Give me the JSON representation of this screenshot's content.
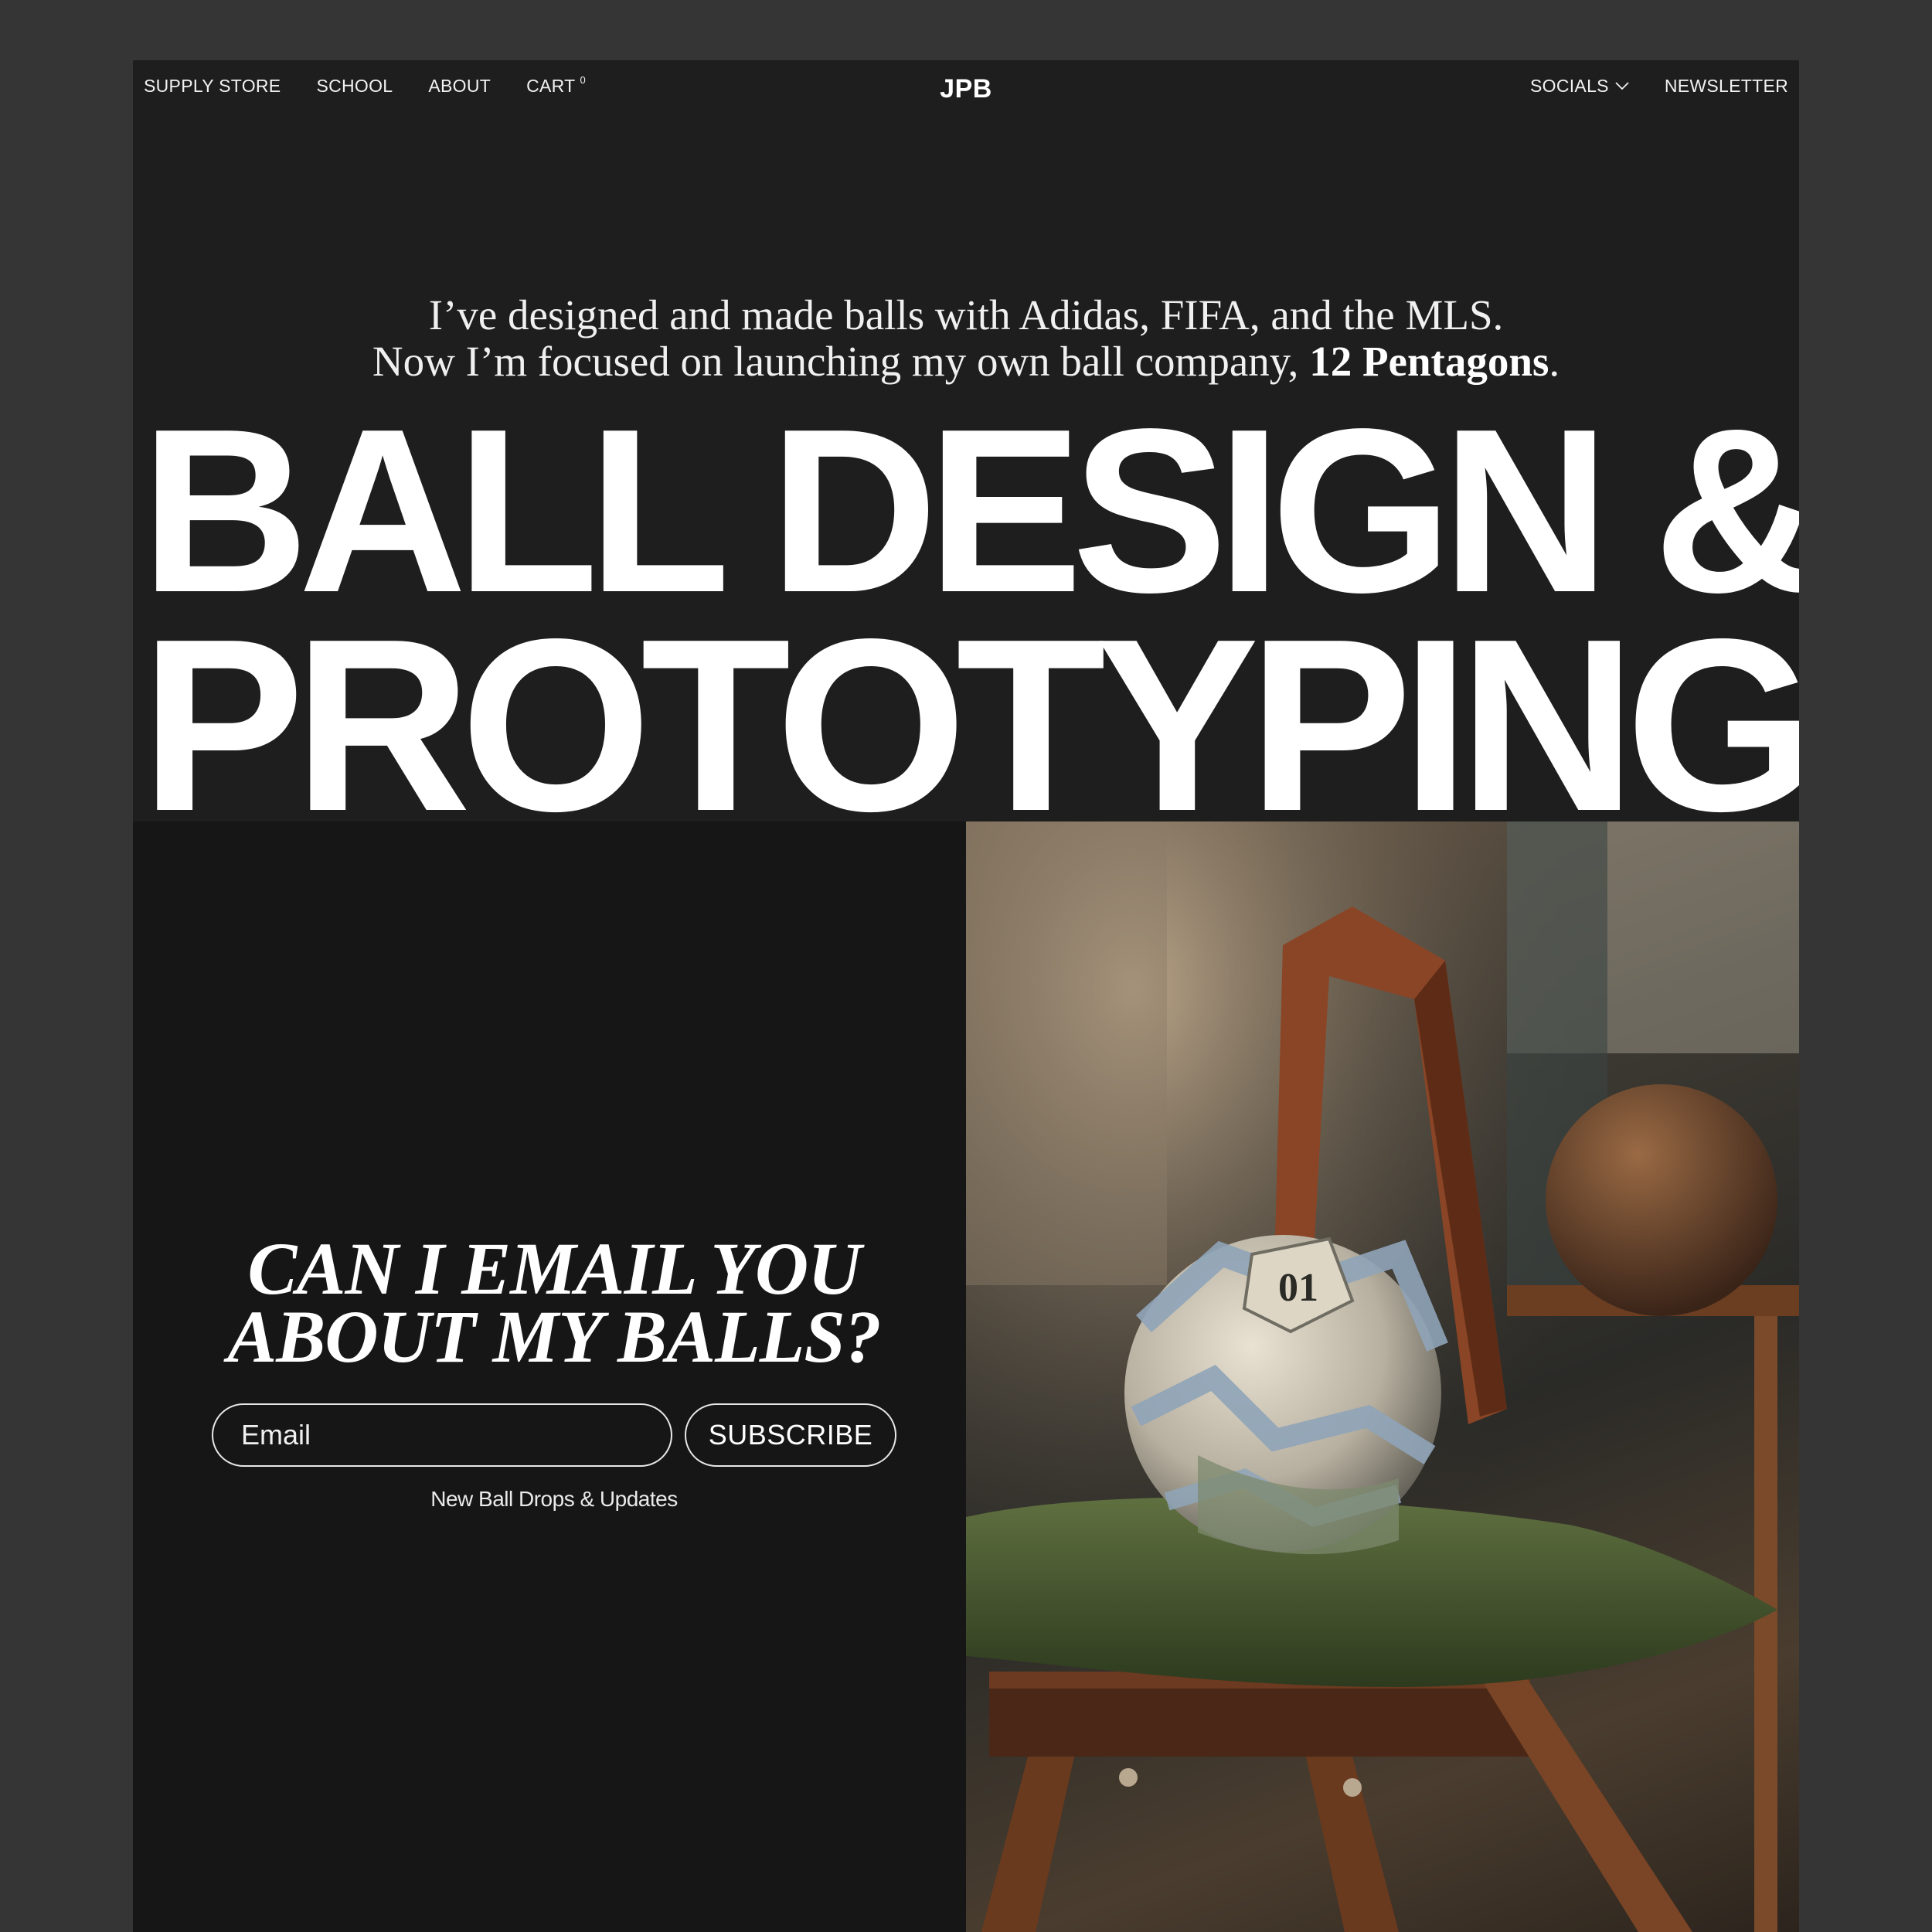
{
  "nav": {
    "left": [
      "SUPPLY STORE",
      "SCHOOL",
      "ABOUT",
      "CART"
    ],
    "cart_count": "0",
    "logo": "JPB",
    "right": [
      "SOCIALS",
      "NEWSLETTER"
    ]
  },
  "intro": {
    "line1": "I’ve designed and made balls with Adidas, FIFA, and the MLS.",
    "line2_prefix": "Now I’m focused on launching my own ball company, ",
    "line2_brand": "12 Pentagons",
    "line2_suffix": "."
  },
  "hero": {
    "line1": "BALL DESIGN &",
    "line2": "PROTOTYPING"
  },
  "signup": {
    "title_line1": "CAN I EMAIL YOU",
    "title_line2": "ABOUT MY BALLS?",
    "email_placeholder": "Email",
    "button_label": "SUBSCRIBE",
    "note": "New Ball Drops & Updates"
  },
  "photo": {
    "ball_label": "01"
  },
  "colors": {
    "outer_bg": "#353535",
    "page_bg": "#1e1e1e",
    "lower_bg": "#161616",
    "text": "#ffffff"
  }
}
